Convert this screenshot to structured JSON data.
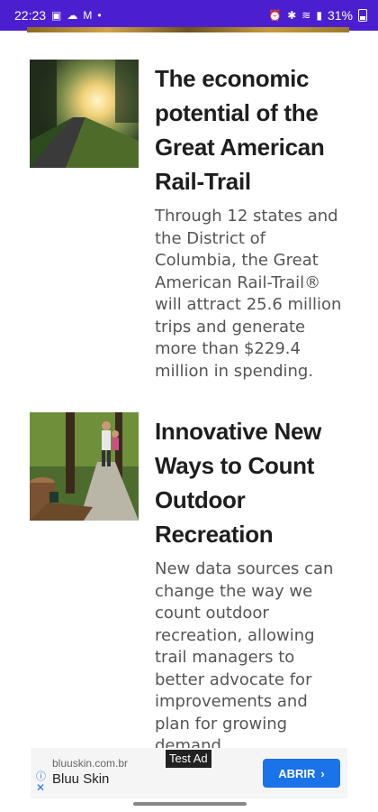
{
  "status_bar": {
    "time": "22:23",
    "battery_percent": "31%",
    "left_icons": [
      "photo-icon",
      "cloud-icon",
      "gmail-icon",
      "dot-icon"
    ],
    "right_icons": [
      "alarm-icon",
      "bluetooth-icon",
      "wifi-icon",
      "signal-icon",
      "battery-icon"
    ]
  },
  "articles": [
    {
      "title_lines": [
        "The economic",
        "potential of the",
        "Great American",
        "Rail-Trail"
      ],
      "summary_lines": [
        "Through 12 states and",
        "the District of",
        "Columbia, the Great",
        "American Rail-Trail®",
        "will attract 25.6 million",
        "trips and generate",
        "more than $229.4",
        "million in spending."
      ],
      "image": "rail-trail-sunset-photo"
    },
    {
      "title_lines": [
        "Innovative New",
        "Ways to Count",
        "Outdoor",
        "Recreation"
      ],
      "summary_lines": [
        "New data sources can",
        "change the way we",
        "count outdoor",
        "recreation, allowing",
        "trail managers to",
        "better advocate for",
        "improvements and",
        "plan for growing",
        "demand"
      ],
      "image": "trail-counter-hikers-photo"
    }
  ],
  "ad": {
    "label": "Test Ad",
    "domain": "bluuskin.com.br",
    "brand": "Bluu Skin",
    "cta": "ABRIR",
    "info_icon": "info-icon",
    "close_icon": "close-icon",
    "accent_color": "#1a73e8"
  },
  "colors": {
    "status_bar": "#4b1fd0",
    "title": "#1e1e1e",
    "summary": "#555555"
  }
}
